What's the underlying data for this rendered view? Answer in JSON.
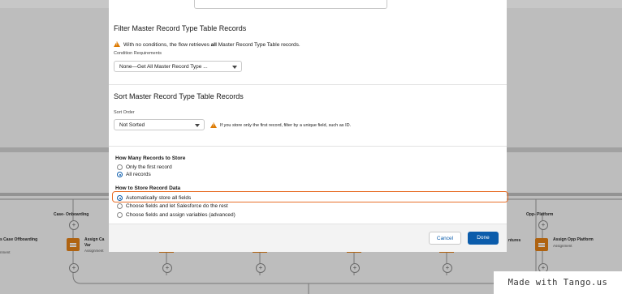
{
  "modal": {
    "top_field_value": "",
    "filter": {
      "title": "Filter Master Record Type Table Records",
      "notice_pre": "With no conditions, the flow retrieves ",
      "notice_bold": "all",
      "notice_post": " Master Record Type Table records.",
      "condition_label": "Condition Requirements",
      "condition_value": "None—Get All Master Record Type ..."
    },
    "sort": {
      "title": "Sort Master Record Type Table Records",
      "order_label": "Sort Order",
      "order_value": "Not Sorted",
      "hint": "If you store only the first record, filter by a unique field, such as ID."
    },
    "how_many": {
      "title": "How Many Records to Store",
      "options": [
        "Only the first record",
        "All records"
      ],
      "selected": "All records"
    },
    "how_to_store": {
      "title": "How to Store Record Data",
      "options": [
        "Automatically store all fields",
        "Choose fields and let Salesforce do the rest",
        "Choose fields and assign variables (advanced)"
      ],
      "selected": "Automatically store all fields"
    },
    "buttons": {
      "cancel": "Cancel",
      "done": "Done"
    }
  },
  "canvas": {
    "nodes": {
      "case_onboarding": "Case- Onboarding",
      "case_offboarding": "s Case Offboarding",
      "case_offboarding_sub": "nment",
      "assign_ca": "Assign Ca",
      "assign_ca_line2": "Var",
      "assign_ca_sub": "Assignment",
      "assignment_mid": "Assignment",
      "opp_platform": "Opp- Platform",
      "ntures": "ntures",
      "assign_opp_platform": "Assign Opp Platform",
      "assign_opp_sub": "Assignment"
    }
  },
  "watermark": "Made with Tango.us",
  "colors": {
    "accent": "#0b5cab",
    "warning": "#dd7a01",
    "highlight": "#e8702a",
    "assignment": "#e07f17"
  }
}
